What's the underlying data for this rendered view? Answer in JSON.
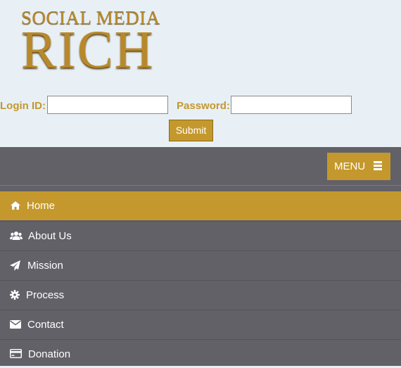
{
  "logo": {
    "line1": "SOCIAL MEDIA",
    "line2": "RICH"
  },
  "login": {
    "id_label": "Login ID:",
    "id_value": "",
    "password_label": "Password:",
    "password_value": "",
    "submit_label": "Submit"
  },
  "nav": {
    "menu_label": "MENU",
    "items": [
      {
        "label": "Home",
        "icon": "home-icon",
        "active": true
      },
      {
        "label": "About Us",
        "icon": "users-icon",
        "active": false
      },
      {
        "label": "Mission",
        "icon": "paper-plane-icon",
        "active": false
      },
      {
        "label": "Process",
        "icon": "gear-icon",
        "active": false
      },
      {
        "label": "Contact",
        "icon": "envelope-icon",
        "active": false
      },
      {
        "label": "Donation",
        "icon": "credit-card-icon",
        "active": false
      }
    ]
  },
  "colors": {
    "gold": "#c4982c",
    "nav_bg": "#636168",
    "header_bg": "#e8f0f5"
  }
}
